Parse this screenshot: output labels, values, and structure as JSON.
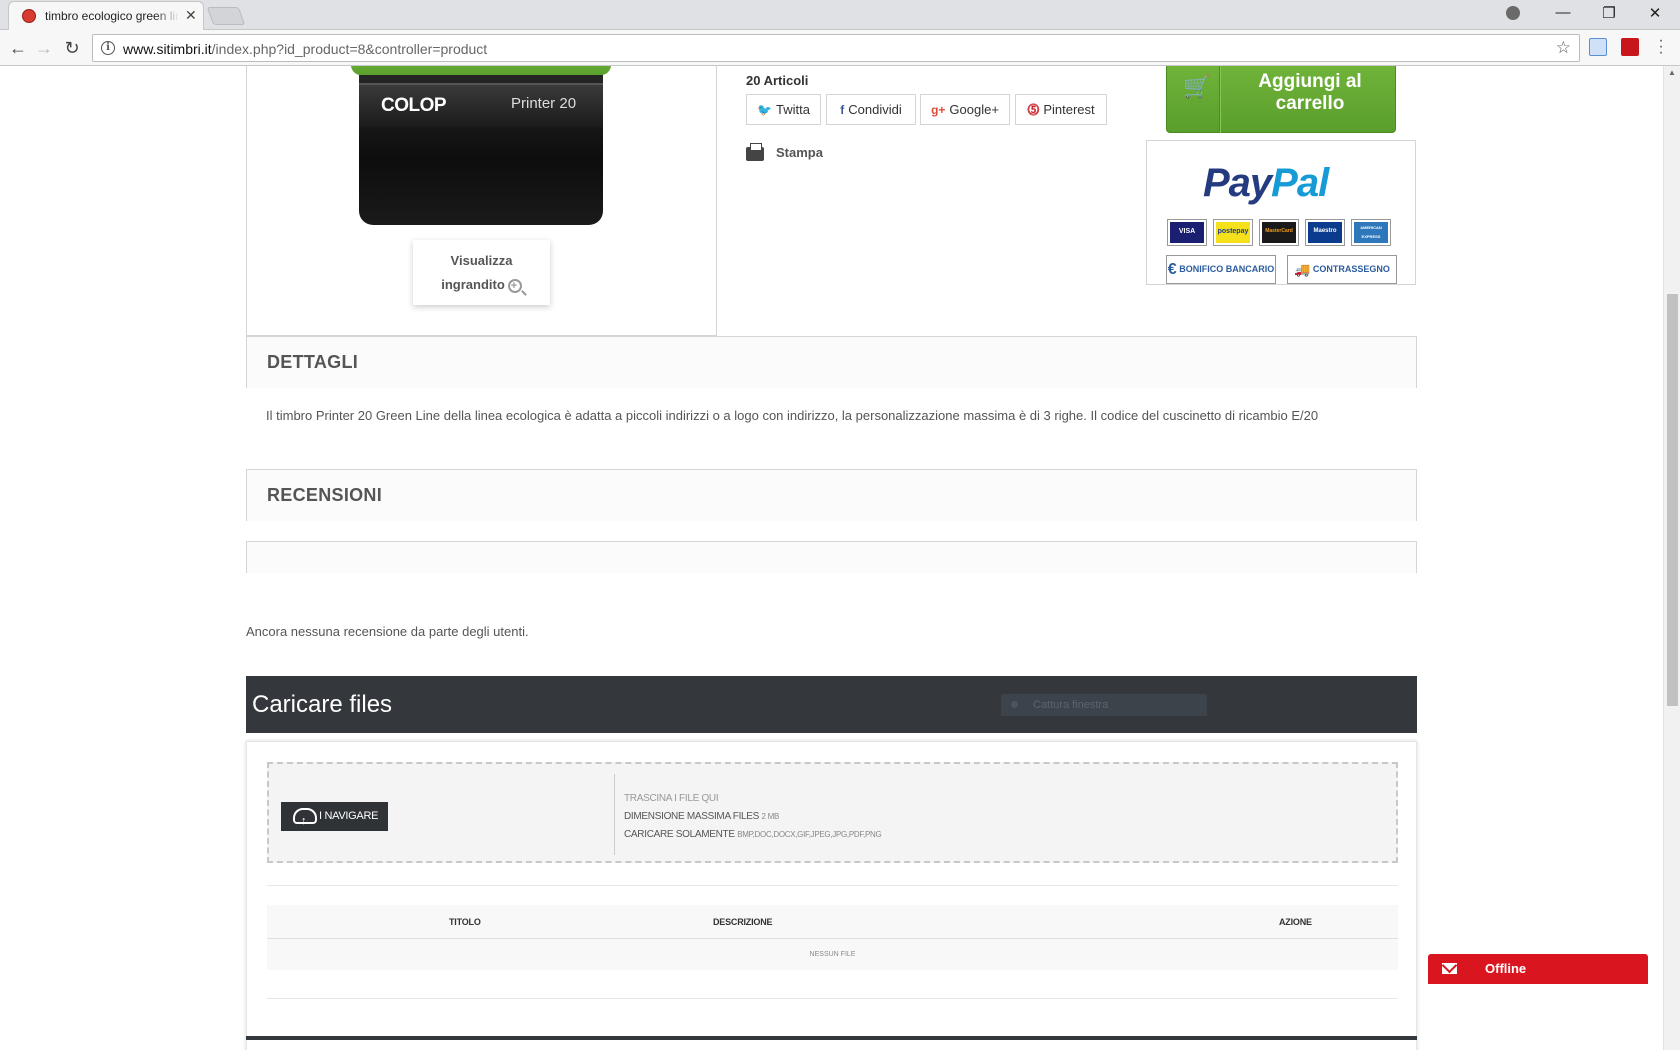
{
  "browser": {
    "tab_title": "timbro ecologico green line",
    "tab_close": "✕",
    "url_host": "www.sitimbri.it",
    "url_path": "/index.php?id_product=8&controller=product",
    "win_min": "—",
    "win_max": "❐",
    "win_close": "✕",
    "back": "←",
    "forward": "→",
    "reload": "↻",
    "info": "i",
    "star": "☆"
  },
  "product": {
    "stamp_brand": "COLOP",
    "stamp_model": "Printer 20",
    "zoom_line1": "Visualizza",
    "zoom_line2": "ingrandito",
    "articles": "20 Articoli",
    "share": {
      "twitter": "Twitta",
      "facebook": "Condividi",
      "google": "Google+",
      "pinterest": "Pinterest"
    },
    "print": "Stampa"
  },
  "cart": {
    "label_line1": "Aggiungi al",
    "label_line2": "carrello",
    "icon": "🛒"
  },
  "payment": {
    "paypal_part1": "Pay",
    "paypal_part2": "Pal",
    "cards": [
      "VISA",
      "postepay",
      "MasterCard",
      "Maestro",
      "AMERICAN EXPRESS"
    ],
    "bonifico": "BONIFICO BANCARIO",
    "contrassegno": "CONTRASSEGNO"
  },
  "details": {
    "title": "DETTAGLI",
    "text": "Il timbro Printer 20 Green Line della linea ecologica è adatta a piccoli indirizzi o a logo con indirizzo, la personalizzazione massima è di 3 righe. Il codice del cuscinetto di ricambio E/20"
  },
  "reviews": {
    "title": "RECENSIONI",
    "empty": "Ancora nessuna recensione da parte degli utenti."
  },
  "upload": {
    "title": "Caricare files",
    "capture": "Cattura finestra",
    "browse": "I NAVIGARE",
    "drop_here": "TRASCINA I FILE QUI",
    "max_size_label": "DIMENSIONE MASSIMA FILES",
    "max_size_value": "2 MB",
    "only_label": "CARICARE SOLAMENTE",
    "only_value": "BMP,DOC,DOCX,GIF,JPEG,JPG,PDF,PNG",
    "columns": [
      "TITOLO",
      "DESCRIZIONE",
      "AZIONE"
    ],
    "empty": "NESSUN FILE"
  },
  "chat": {
    "status": "Offline"
  }
}
